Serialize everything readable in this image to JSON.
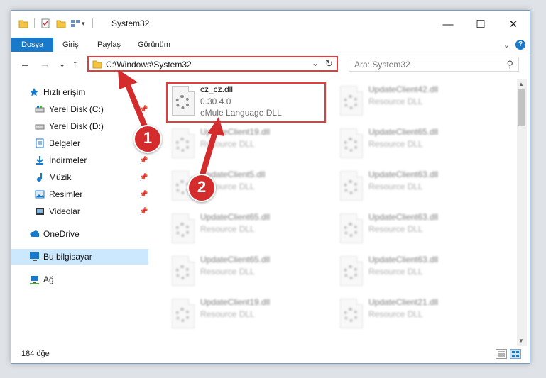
{
  "window": {
    "title": "System32",
    "controls": {
      "minimize": "—",
      "maximize": "☐",
      "close": "✕"
    }
  },
  "ribbon": {
    "tabs": [
      "Dosya",
      "Giriş",
      "Paylaş",
      "Görünüm"
    ],
    "expand_symbol": "⌄",
    "help_symbol": "?"
  },
  "navigation": {
    "back": "←",
    "forward": "→",
    "recent": "⌄",
    "up": "↑",
    "address": "C:\\Windows\\System32",
    "address_dropdown": "⌄",
    "refresh": "↻",
    "search_placeholder": "Ara: System32",
    "search_symbol": "⚲"
  },
  "sidebar": {
    "items": [
      {
        "label": "Hızlı erişim",
        "icon": "star-icon",
        "pinned": false
      },
      {
        "label": "Yerel Disk (C:)",
        "icon": "drive-icon",
        "pinned": true
      },
      {
        "label": "Yerel Disk (D:)",
        "icon": "drive-icon",
        "pinned": true
      },
      {
        "label": "Belgeler",
        "icon": "document-icon",
        "pinned": true
      },
      {
        "label": "İndirmeler",
        "icon": "download-icon",
        "pinned": true
      },
      {
        "label": "Müzik",
        "icon": "music-icon",
        "pinned": true
      },
      {
        "label": "Resimler",
        "icon": "picture-icon",
        "pinned": true
      },
      {
        "label": "Videolar",
        "icon": "video-icon",
        "pinned": true
      },
      {
        "label": "OneDrive",
        "icon": "cloud-icon",
        "pinned": false
      },
      {
        "label": "Bu bilgisayar",
        "icon": "computer-icon",
        "pinned": false,
        "selected": true
      },
      {
        "label": "Ağ",
        "icon": "network-icon",
        "pinned": false
      }
    ],
    "pin_symbol": "📌"
  },
  "files": {
    "selected": {
      "name": "cz_cz.dll",
      "version": "0.30.4.0",
      "description": "eMule Language DLL"
    },
    "left_column": [
      {
        "name": "UpdateClient19.dll",
        "type": "Resource DLL"
      },
      {
        "name": "UpdateClient5.dll",
        "type": "Resource DLL"
      },
      {
        "name": "UpdateClient65.dll",
        "type": "Resource DLL"
      },
      {
        "name": "UpdateClient65.dll",
        "type": "Resource DLL"
      },
      {
        "name": "UpdateClient19.dll",
        "type": "Resource DLL"
      }
    ],
    "right_column": [
      {
        "name": "UpdateClient42.dll",
        "type": "Resource DLL"
      },
      {
        "name": "UpdateClient65.dll",
        "type": "Resource DLL"
      },
      {
        "name": "UpdateClient63.dll",
        "type": "Resource DLL"
      },
      {
        "name": "UpdateClient63.dll",
        "type": "Resource DLL"
      },
      {
        "name": "UpdateClient63.dll",
        "type": "Resource DLL"
      },
      {
        "name": "UpdateClient21.dll",
        "type": "Resource DLL"
      }
    ]
  },
  "status": {
    "item_count": "184 öğe"
  },
  "annotations": {
    "step1": "1",
    "step2": "2",
    "color": "#d42c2c"
  }
}
